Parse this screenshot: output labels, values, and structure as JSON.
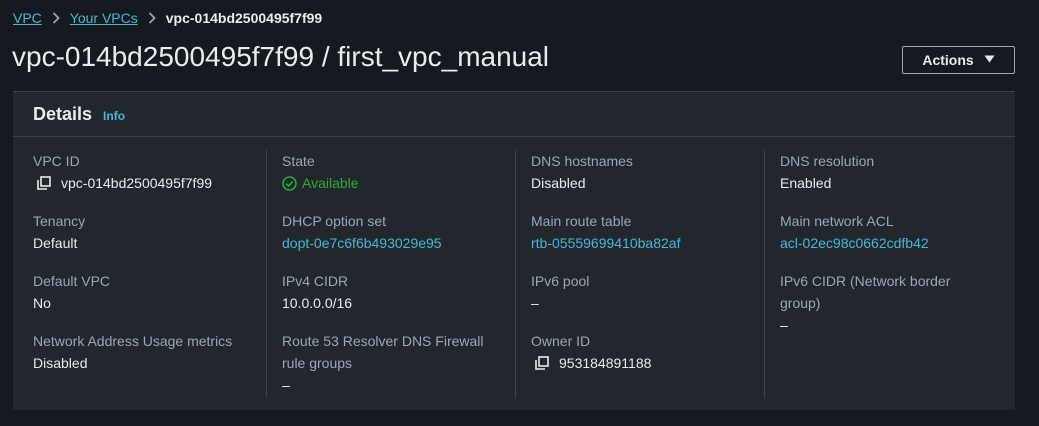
{
  "breadcrumb": {
    "items": [
      "VPC",
      "Your VPCs"
    ],
    "current": "vpc-014bd2500495f7f99"
  },
  "page_title": "vpc-014bd2500495f7f99 / first_vpc_manual",
  "actions_label": "Actions",
  "details": {
    "title": "Details",
    "info": "Info"
  },
  "fields": {
    "vpc_id": {
      "label": "VPC ID",
      "value": "vpc-014bd2500495f7f99"
    },
    "state": {
      "label": "State",
      "value": "Available"
    },
    "dns_hostnames": {
      "label": "DNS hostnames",
      "value": "Disabled"
    },
    "dns_resolution": {
      "label": "DNS resolution",
      "value": "Enabled"
    },
    "tenancy": {
      "label": "Tenancy",
      "value": "Default"
    },
    "dhcp_option_set": {
      "label": "DHCP option set",
      "value": "dopt-0e7c6f6b493029e95"
    },
    "main_route_table": {
      "label": "Main route table",
      "value": "rtb-05559699410ba82af"
    },
    "main_network_acl": {
      "label": "Main network ACL",
      "value": "acl-02ec98c0662cdfb42"
    },
    "default_vpc": {
      "label": "Default VPC",
      "value": "No"
    },
    "ipv4_cidr": {
      "label": "IPv4 CIDR",
      "value": "10.0.0.0/16"
    },
    "ipv6_pool": {
      "label": "IPv6 pool",
      "value": "–"
    },
    "ipv6_cidr": {
      "label": "IPv6 CIDR (Network border group)",
      "value": "–"
    },
    "network_address_usage": {
      "label": "Network Address Usage metrics",
      "value": "Disabled"
    },
    "route53_firewall": {
      "label": "Route 53 Resolver DNS Firewall rule groups",
      "value": "–"
    },
    "owner_id": {
      "label": "Owner ID",
      "value": "953184891188"
    }
  },
  "colors": {
    "link": "#44b9d6",
    "success": "#29ad32",
    "background": "#16191f",
    "panel": "#22262d"
  },
  "icons": {
    "breadcrumb_separator": "chevron-right-icon",
    "copy": "copy-icon",
    "status": "check-circle-icon",
    "dropdown": "caret-down-icon"
  }
}
